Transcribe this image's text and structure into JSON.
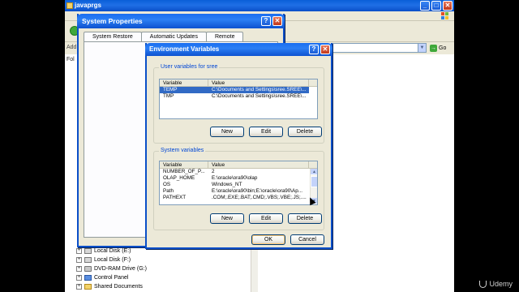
{
  "explorer": {
    "title": "javaprgs",
    "address_label": "Add",
    "go_label": "Go",
    "folders_label": "Fol",
    "tree": [
      {
        "label": "Local Disk (E:)",
        "icon": "drive-icon"
      },
      {
        "label": "Local Disk (F:)",
        "icon": "drive-icon"
      },
      {
        "label": "DVD-RAM Drive (G:)",
        "icon": "cdrom-icon"
      },
      {
        "label": "Control Panel",
        "icon": "control-panel-icon"
      },
      {
        "label": "Shared Documents",
        "icon": "folder-icon"
      }
    ]
  },
  "system_properties": {
    "title": "System Properties",
    "tabs": [
      "System Restore",
      "Automatic Updates",
      "Remote"
    ],
    "help": "?",
    "close": "✕"
  },
  "env_vars": {
    "title": "Environment Variables",
    "help": "?",
    "close": "✕",
    "user_group_label": "User variables for sree",
    "system_group_label": "System variables",
    "col_variable": "Variable",
    "col_value": "Value",
    "user_rows": [
      {
        "variable": "TEMP",
        "value": "C:\\Documents and Settings\\sree.SREE\\...",
        "selected": true
      },
      {
        "variable": "TMP",
        "value": "C:\\Documents and Settings\\sree.SREE\\..."
      }
    ],
    "system_rows": [
      {
        "variable": "NUMBER_OF_P...",
        "value": "2"
      },
      {
        "variable": "OLAP_HOME",
        "value": "E:\\oracle\\ora90\\olap"
      },
      {
        "variable": "OS",
        "value": "Windows_NT"
      },
      {
        "variable": "Path",
        "value": "E:\\oracle\\ora90\\bin;E:\\oracle\\ora90\\Ap..."
      },
      {
        "variable": "PATHEXT",
        "value": ".COM;.EXE;.BAT;.CMD;.VBS;.VBE;.JS;...."
      }
    ],
    "new_label": "New",
    "edit_label": "Edit",
    "delete_label": "Delete",
    "ok_label": "OK",
    "cancel_label": "Cancel"
  },
  "watermark": "Udemy"
}
